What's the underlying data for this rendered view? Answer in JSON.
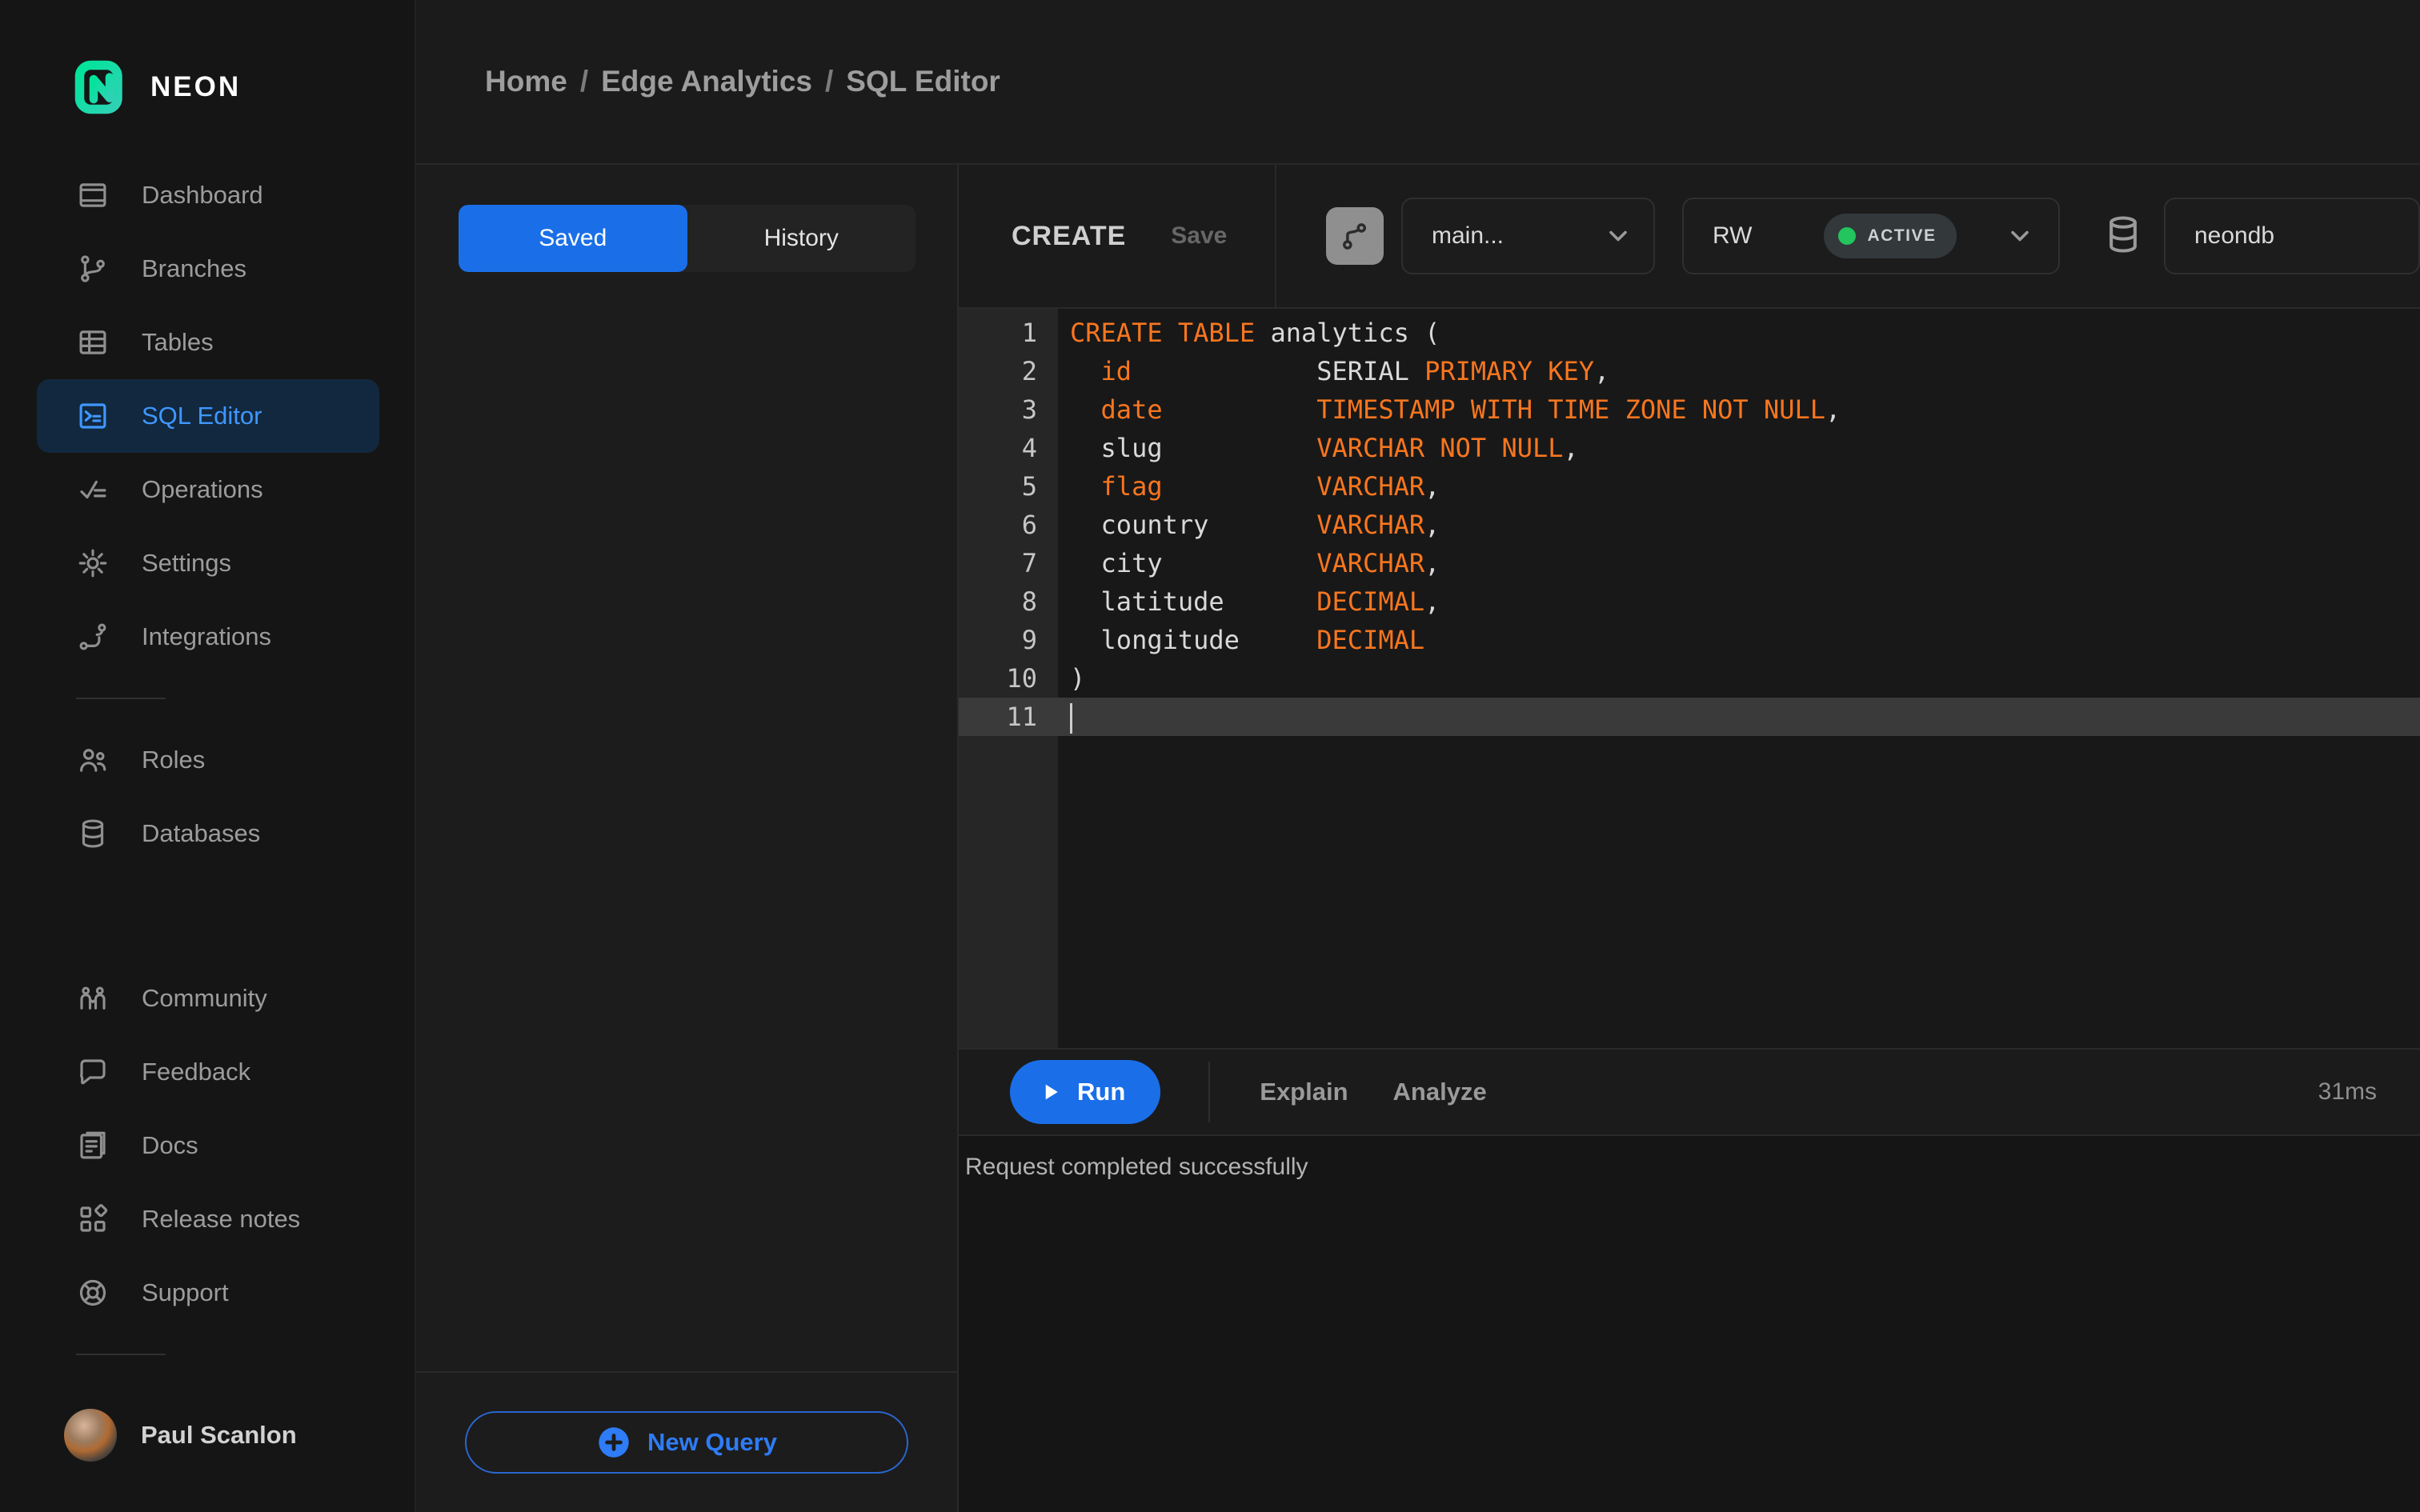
{
  "brand": {
    "name": "NEON"
  },
  "sidebar": {
    "nav_main": [
      {
        "label": "Dashboard",
        "icon": "dashboard"
      },
      {
        "label": "Branches",
        "icon": "branches"
      },
      {
        "label": "Tables",
        "icon": "tables"
      },
      {
        "label": "SQL Editor",
        "icon": "sql-editor",
        "active": true
      },
      {
        "label": "Operations",
        "icon": "operations"
      },
      {
        "label": "Settings",
        "icon": "settings"
      },
      {
        "label": "Integrations",
        "icon": "integrations"
      }
    ],
    "nav_secondary": [
      {
        "label": "Roles",
        "icon": "roles"
      },
      {
        "label": "Databases",
        "icon": "databases"
      }
    ],
    "nav_bottom": [
      {
        "label": "Community",
        "icon": "community"
      },
      {
        "label": "Feedback",
        "icon": "feedback"
      },
      {
        "label": "Docs",
        "icon": "docs"
      },
      {
        "label": "Release notes",
        "icon": "release-notes"
      },
      {
        "label": "Support",
        "icon": "support"
      }
    ],
    "user": {
      "name": "Paul Scanlon"
    }
  },
  "breadcrumb": {
    "items": [
      "Home",
      "Edge Analytics",
      "SQL Editor"
    ],
    "separator": "/"
  },
  "queries_panel": {
    "tabs": [
      {
        "label": "Saved",
        "active": true
      },
      {
        "label": "History",
        "active": false
      }
    ],
    "new_query_label": "New Query"
  },
  "editor": {
    "title": "CREATE",
    "save_label": "Save",
    "branch_select": {
      "value": "main..."
    },
    "endpoint_select": {
      "value": "RW",
      "status": "ACTIVE"
    },
    "database_select": {
      "value": "neondb"
    },
    "code": {
      "active_line": 11,
      "lines": [
        {
          "num": 1,
          "tokens": [
            [
              "kw",
              "CREATE TABLE"
            ],
            [
              "pl",
              " analytics ("
            ]
          ]
        },
        {
          "num": 2,
          "tokens": [
            [
              "pl",
              "  "
            ],
            [
              "kw",
              "id"
            ],
            [
              "pl",
              "            "
            ],
            [
              "pl",
              "SERIAL "
            ],
            [
              "kw",
              "PRIMARY KEY"
            ],
            [
              "pl",
              ","
            ]
          ]
        },
        {
          "num": 3,
          "tokens": [
            [
              "pl",
              "  "
            ],
            [
              "kw",
              "date"
            ],
            [
              "pl",
              "          "
            ],
            [
              "kw",
              "TIMESTAMP WITH TIME ZONE NOT NULL"
            ],
            [
              "pl",
              ","
            ]
          ]
        },
        {
          "num": 4,
          "tokens": [
            [
              "pl",
              "  slug          "
            ],
            [
              "kw",
              "VARCHAR NOT NULL"
            ],
            [
              "pl",
              ","
            ]
          ]
        },
        {
          "num": 5,
          "tokens": [
            [
              "pl",
              "  "
            ],
            [
              "kw",
              "flag"
            ],
            [
              "pl",
              "          "
            ],
            [
              "kw",
              "VARCHAR"
            ],
            [
              "pl",
              ","
            ]
          ]
        },
        {
          "num": 6,
          "tokens": [
            [
              "pl",
              "  country       "
            ],
            [
              "kw",
              "VARCHAR"
            ],
            [
              "pl",
              ","
            ]
          ]
        },
        {
          "num": 7,
          "tokens": [
            [
              "pl",
              "  city          "
            ],
            [
              "kw",
              "VARCHAR"
            ],
            [
              "pl",
              ","
            ]
          ]
        },
        {
          "num": 8,
          "tokens": [
            [
              "pl",
              "  latitude      "
            ],
            [
              "kw",
              "DECIMAL"
            ],
            [
              "pl",
              ","
            ]
          ]
        },
        {
          "num": 9,
          "tokens": [
            [
              "pl",
              "  longitude     "
            ],
            [
              "kw",
              "DECIMAL"
            ]
          ]
        },
        {
          "num": 10,
          "tokens": [
            [
              "pl",
              ")"
            ]
          ]
        },
        {
          "num": 11,
          "tokens": []
        }
      ]
    },
    "toolbar": {
      "run_label": "Run",
      "explain_label": "Explain",
      "analyze_label": "Analyze",
      "duration": "31ms"
    },
    "status_message": "Request completed successfully"
  },
  "colors": {
    "accent_blue": "#1a6fe8",
    "link_blue": "#3f97ff",
    "code_keyword_orange": "#f8761f",
    "active_green": "#22c55e",
    "logo_green": "#00e599"
  }
}
